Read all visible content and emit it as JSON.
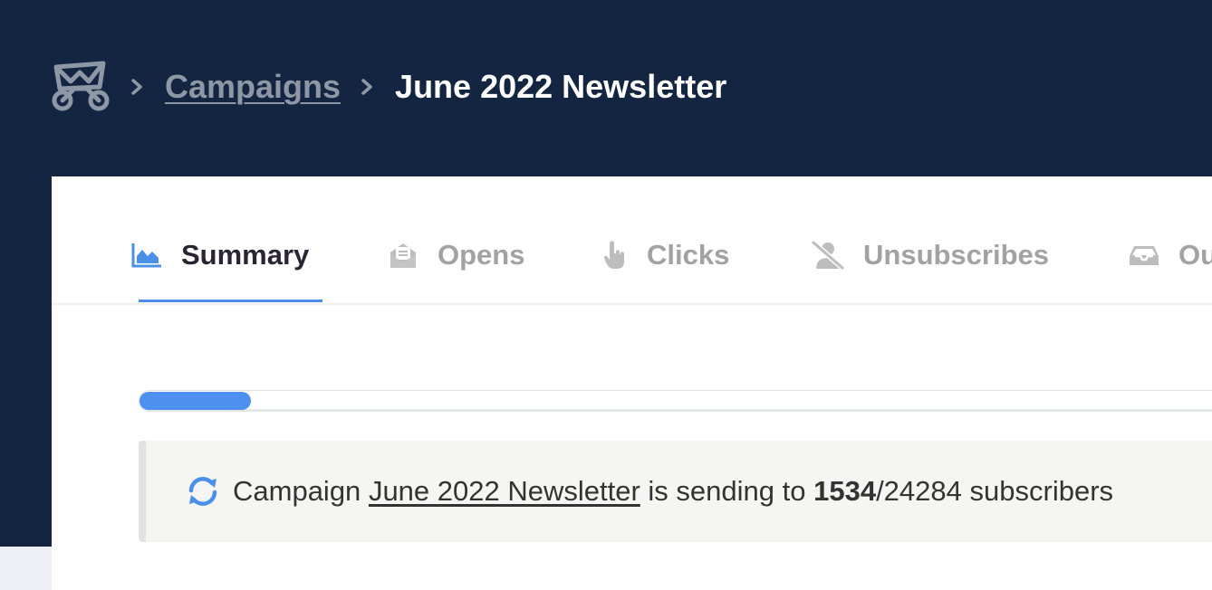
{
  "breadcrumb": {
    "logo_icon": "envelope-bicycle-logo-icon",
    "parent_label": "Campaigns",
    "current_label": "June 2022 Newsletter",
    "separator_icon": "chevron-right-icon"
  },
  "tabs": [
    {
      "label": "Summary",
      "icon": "area-chart-icon",
      "active": true
    },
    {
      "label": "Opens",
      "icon": "envelope-open-icon",
      "active": false
    },
    {
      "label": "Clicks",
      "icon": "pointer-hand-icon",
      "active": false
    },
    {
      "label": "Unsubscribes",
      "icon": "user-slash-icon",
      "active": false
    },
    {
      "label": "Ou",
      "icon": "inbox-icon",
      "active": false
    }
  ],
  "progress": {
    "sent": 1534,
    "total": 24284,
    "fraction": 0.0632
  },
  "notice": {
    "icon": "sync-icon",
    "prefix": "Campaign",
    "campaign_link": "June 2022 Newsletter",
    "middle": "is sending to",
    "sent": "1534",
    "slash_total": "/24284",
    "suffix": "subscribers"
  },
  "colors": {
    "header_bg": "#132541",
    "accent": "#4a90e8",
    "tab_inactive": "#a2a2a2",
    "tab_active": "#2b2433"
  }
}
